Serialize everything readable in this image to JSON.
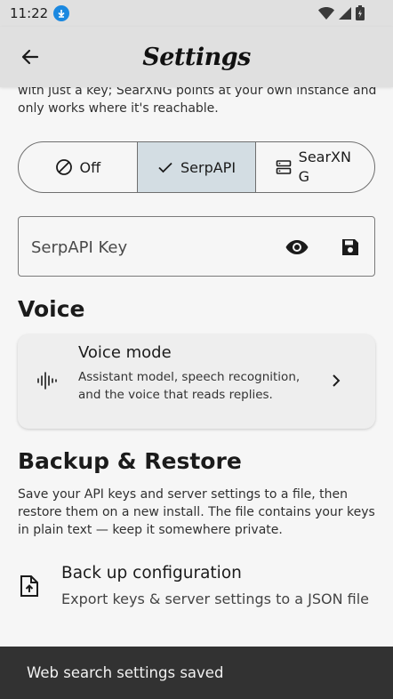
{
  "status_bar": {
    "time": "11:22"
  },
  "app_bar": {
    "title": "Settings"
  },
  "web_search": {
    "intro_text": "with just a key; SearXNG points at your own instance and only works where it's reachable.",
    "options": [
      {
        "label": "Off",
        "icon": "block-icon",
        "selected": false
      },
      {
        "label": "SerpAPI",
        "icon": "check-icon",
        "selected": true
      },
      {
        "label": "SearXNG",
        "icon": "server-icon",
        "selected": false
      }
    ],
    "key_field": {
      "placeholder": "SerpAPI Key",
      "value": ""
    }
  },
  "voice": {
    "heading": "Voice",
    "card_title": "Voice mode",
    "card_desc": "Assistant model, speech recognition, and the voice that reads replies."
  },
  "backup": {
    "heading": "Backup & Restore",
    "description": "Save your API keys and server settings to a file, then restore them on a new install. The file contains your keys in plain text — keep it somewhere private.",
    "row_title": "Back up configuration",
    "row_sub": "Export keys & server settings to a JSON file"
  },
  "snackbar": {
    "message": "Web search settings saved"
  },
  "colors": {
    "selected_segment": "#d3dde3",
    "snackbar_bg": "#323232",
    "download_badge": "#1a88e0"
  }
}
